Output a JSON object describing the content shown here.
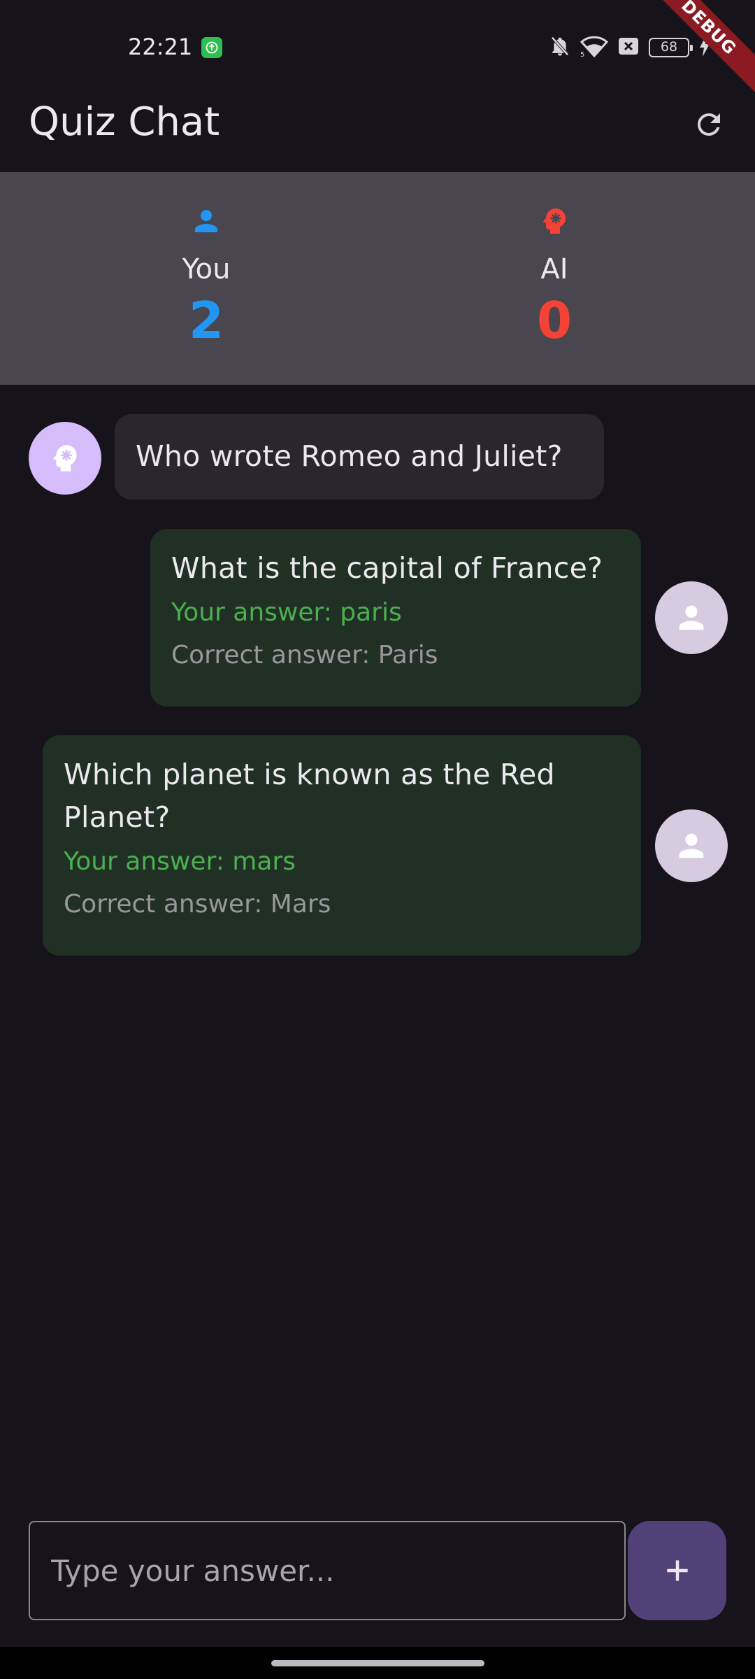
{
  "status_bar": {
    "time": "22:21",
    "battery": "68",
    "icons": [
      "app-notification-icon",
      "bell-off-icon",
      "wifi-icon",
      "sim-icon",
      "battery-icon",
      "charging-icon"
    ]
  },
  "debug_banner": "DEBUG",
  "app_bar": {
    "title": "Quiz Chat",
    "refresh_icon": "refresh-icon"
  },
  "scores": {
    "you": {
      "label": "You",
      "value": "2",
      "icon": "person-icon",
      "color": "#2196f3"
    },
    "ai": {
      "label": "AI",
      "value": "0",
      "icon": "psychology-icon",
      "color": "#f44336"
    }
  },
  "messages": [
    {
      "sender": "ai",
      "question": "Who wrote Romeo and Juliet?"
    },
    {
      "sender": "user",
      "question": "What is the capital of France?",
      "your_answer": "Your answer: paris",
      "correct_answer": "Correct answer: Paris"
    },
    {
      "sender": "user",
      "question": "Which planet is known as the Red Planet?",
      "your_answer": "Your answer: mars",
      "correct_answer": "Correct answer: Mars"
    }
  ],
  "input": {
    "placeholder": "Type your answer...",
    "value": ""
  },
  "colors": {
    "background": "#16141a",
    "scoreboard": "#4a4650",
    "correct_bubble": "#213024",
    "correct_text": "#4caf50",
    "send_button": "#524178"
  }
}
